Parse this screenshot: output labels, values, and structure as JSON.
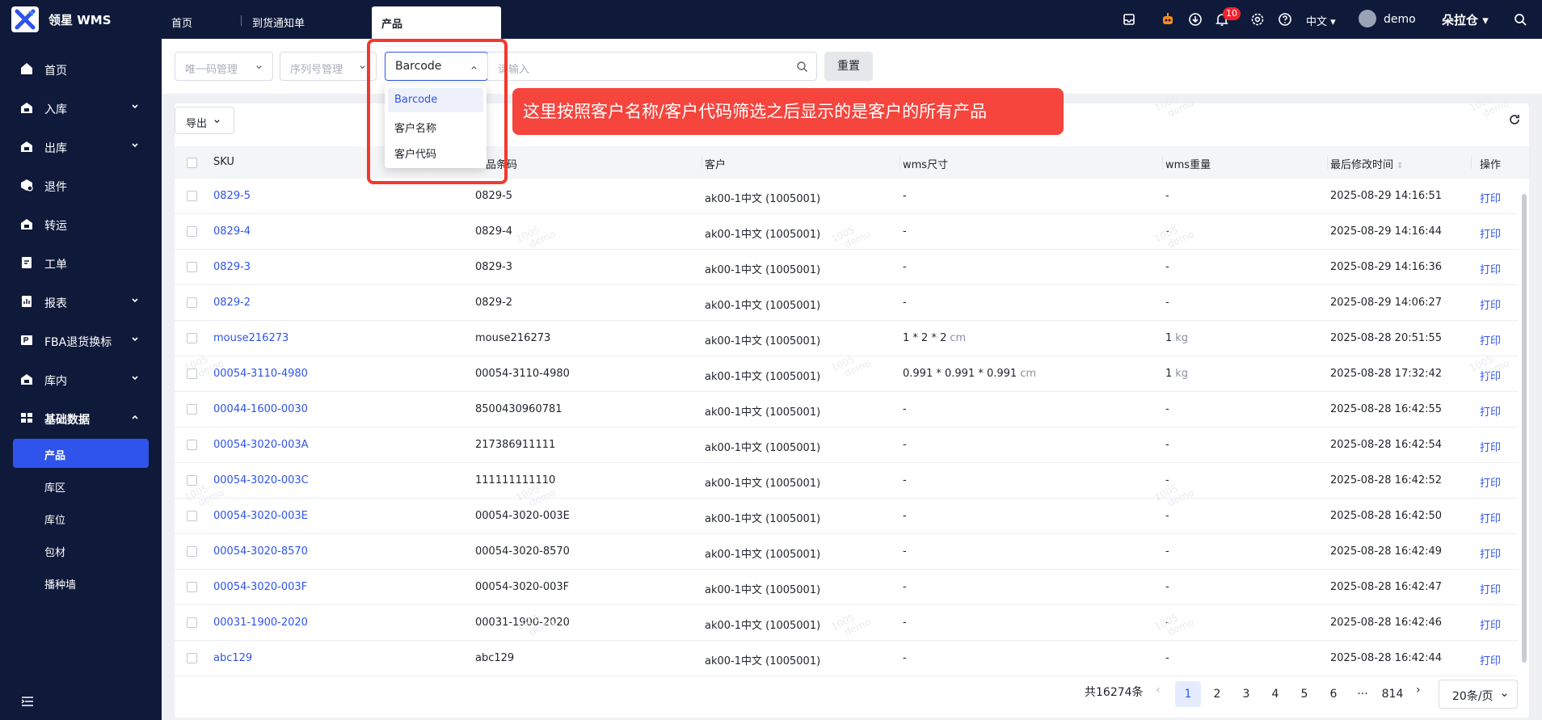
{
  "header": {
    "brand": "领星 WMS",
    "tabs": [
      {
        "label": "首页"
      },
      {
        "label": "到货通知单"
      },
      {
        "label": "产品"
      }
    ],
    "notification_count": "10",
    "language": "中文",
    "user": "demo",
    "warehouse": "朵拉仓",
    "icons": [
      "box-icon",
      "robot-icon",
      "download-icon",
      "bell-icon",
      "settings-icon",
      "help-icon",
      "search-icon"
    ]
  },
  "sidebar": {
    "items": [
      {
        "label": "首页",
        "icon": "home-icon"
      },
      {
        "label": "入库",
        "icon": "inbound-icon"
      },
      {
        "label": "出库",
        "icon": "outbound-icon"
      },
      {
        "label": "退件",
        "icon": "return-icon"
      },
      {
        "label": "转运",
        "icon": "transfer-icon"
      },
      {
        "label": "工单",
        "icon": "workorder-icon"
      },
      {
        "label": "报表",
        "icon": "report-icon"
      },
      {
        "label": "FBA退货换标",
        "icon": "fba-icon"
      },
      {
        "label": "库内",
        "icon": "warehouse-icon"
      },
      {
        "label": "基础数据",
        "icon": "grid-icon"
      }
    ],
    "subitems": [
      {
        "label": "产品"
      },
      {
        "label": "库区"
      },
      {
        "label": "库位"
      },
      {
        "label": "包材"
      },
      {
        "label": "播种墙"
      }
    ]
  },
  "filters": {
    "unique_code": "唯一码管理",
    "serial_no": "序列号管理",
    "search_field": "Barcode",
    "search_placeholder": "请输入",
    "reset_label": "重置"
  },
  "dropdown": {
    "options": [
      "Barcode",
      "客户名称",
      "客户代码"
    ],
    "selected": "Barcode"
  },
  "annotation": "这里按照客户名称/客户代码筛选之后显示的是客户的所有产品",
  "toolbar": {
    "export_label": "导出"
  },
  "table": {
    "columns": [
      "SKU",
      "产品条码",
      "客户",
      "wms尺寸",
      "wms重量",
      "最后修改时间",
      "操作"
    ],
    "visible_header_fragment": "品条码",
    "rows": [
      {
        "sku": "0829-5",
        "barcode": "0829-5",
        "customer": "ak00-1中文 (1005001)",
        "size": "-",
        "weight": "-",
        "time": "2025-08-29 14:16:51",
        "action": "打印"
      },
      {
        "sku": "0829-4",
        "barcode": "0829-4",
        "customer": "ak00-1中文 (1005001)",
        "size": "-",
        "weight": "-",
        "time": "2025-08-29 14:16:44",
        "action": "打印"
      },
      {
        "sku": "0829-3",
        "barcode": "0829-3",
        "customer": "ak00-1中文 (1005001)",
        "size": "-",
        "weight": "-",
        "time": "2025-08-29 14:16:36",
        "action": "打印"
      },
      {
        "sku": "0829-2",
        "barcode": "0829-2",
        "customer": "ak00-1中文 (1005001)",
        "size": "-",
        "weight": "-",
        "time": "2025-08-29 14:06:27",
        "action": "打印"
      },
      {
        "sku": "mouse216273",
        "barcode": "mouse216273",
        "customer": "ak00-1中文 (1005001)",
        "size": "1 * 2 * 2",
        "size_unit": "cm",
        "weight": "1",
        "weight_unit": "kg",
        "time": "2025-08-28 20:51:55",
        "action": "打印"
      },
      {
        "sku": "00054-3110-4980",
        "barcode": "00054-3110-4980",
        "customer": "ak00-1中文 (1005001)",
        "size": "0.991 * 0.991 * 0.991",
        "size_unit": "cm",
        "weight": "1",
        "weight_unit": "kg",
        "time": "2025-08-28 17:32:42",
        "action": "打印"
      },
      {
        "sku": "00044-1600-0030",
        "barcode": "8500430960781",
        "customer": "ak00-1中文 (1005001)",
        "size": "-",
        "weight": "-",
        "time": "2025-08-28 16:42:55",
        "action": "打印"
      },
      {
        "sku": "00054-3020-003A",
        "barcode": "217386911111",
        "customer": "ak00-1中文 (1005001)",
        "size": "-",
        "weight": "-",
        "time": "2025-08-28 16:42:54",
        "action": "打印"
      },
      {
        "sku": "00054-3020-003C",
        "barcode": "111111111110",
        "customer": "ak00-1中文 (1005001)",
        "size": "-",
        "weight": "-",
        "time": "2025-08-28 16:42:52",
        "action": "打印"
      },
      {
        "sku": "00054-3020-003E",
        "barcode": "00054-3020-003E",
        "customer": "ak00-1中文 (1005001)",
        "size": "-",
        "weight": "-",
        "time": "2025-08-28 16:42:50",
        "action": "打印"
      },
      {
        "sku": "00054-3020-8570",
        "barcode": "00054-3020-8570",
        "customer": "ak00-1中文 (1005001)",
        "size": "-",
        "weight": "-",
        "time": "2025-08-28 16:42:49",
        "action": "打印"
      },
      {
        "sku": "00054-3020-003F",
        "barcode": "00054-3020-003F",
        "customer": "ak00-1中文 (1005001)",
        "size": "-",
        "weight": "-",
        "time": "2025-08-28 16:42:47",
        "action": "打印"
      },
      {
        "sku": "00031-1900-2020",
        "barcode": "00031-1900-2020",
        "customer": "ak00-1中文 (1005001)",
        "size": "-",
        "weight": "-",
        "time": "2025-08-28 16:42:46",
        "action": "打印"
      },
      {
        "sku": "abc129",
        "barcode": "abc129",
        "customer": "ak00-1中文 (1005001)",
        "size": "-",
        "weight": "-",
        "time": "2025-08-28 16:42:44",
        "action": "打印"
      }
    ]
  },
  "pagination": {
    "total": "共16274条",
    "pages": [
      "1",
      "2",
      "3",
      "4",
      "5",
      "6"
    ],
    "ellipsis": "···",
    "last_page": "814",
    "current": "1",
    "page_size": "20条/页"
  },
  "watermark": {
    "line1": "1005",
    "line2": "demo"
  },
  "colors": {
    "primary": "#2f54eb",
    "nav_bg": "#0f1a3a",
    "annotation_red": "#f5453d",
    "badge_red": "#f5222d"
  }
}
